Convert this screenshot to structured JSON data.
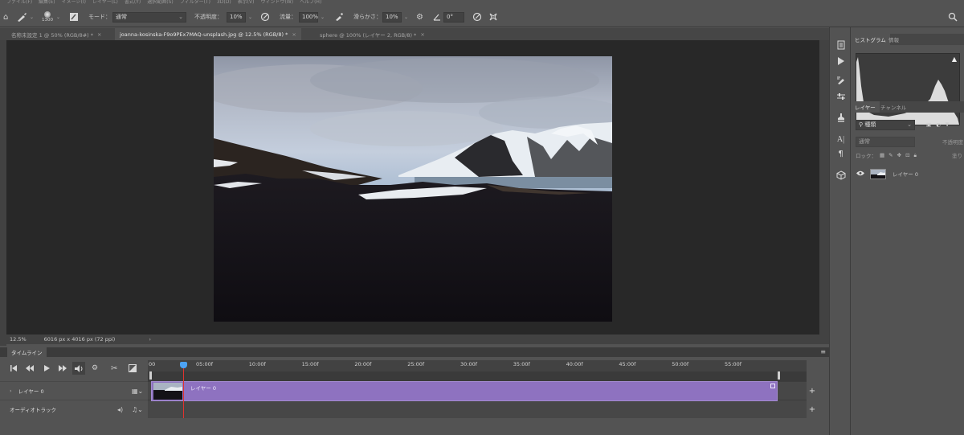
{
  "menu": [
    "ファイル(F)",
    "編集(E)",
    "イメージ(I)",
    "レイヤー(L)",
    "書式(Y)",
    "選択範囲(S)",
    "フィルター(T)",
    "3D(D)",
    "表示(V)",
    "ウィンドウ(W)",
    "ヘルプ(H)"
  ],
  "options": {
    "brush_size": "1300",
    "mode_label": "モード：",
    "mode_value": "通常",
    "opacity_label": "不透明度：",
    "opacity_value": "10%",
    "flow_label": "流量：",
    "flow_value": "100%",
    "smoothing_label": "滑らかさ：",
    "smoothing_value": "10%",
    "angle_value": "0°"
  },
  "tabs": [
    {
      "label": "名称未設定 1 @ 50% (RGB/8#) *",
      "close": "×"
    },
    {
      "label": "joanna-kosinska-F9o9PEx7MAQ-unsplash.jpg @ 12.5% (RGB/8) *",
      "close": "×"
    },
    {
      "label": "sphere @ 100% (レイヤー 2, RGB/8) *",
      "close": "×"
    }
  ],
  "status": {
    "zoom": "12.5%",
    "doc_info": "6016 px x 4016 px (72 ppi)",
    "arrow": "›"
  },
  "timeline": {
    "tab": "タイムライン",
    "menu": "≡",
    "ticks": [
      "00",
      "05:00f",
      "10:00f",
      "15:00f",
      "20:00f",
      "25:00f",
      "30:00f",
      "35:00f",
      "40:00f",
      "45:00f",
      "50:00f",
      "55:00f"
    ],
    "layer_track": "レイヤー 0",
    "audio_track": "オーディオトラック",
    "clip_label": "レイヤー 0",
    "plus": "+"
  },
  "panels": {
    "histogram_tab": "ヒストグラム",
    "info_tab": "情報",
    "layers_tab": "レイヤー",
    "channels_tab": "チャンネル",
    "kind_label": "種類",
    "blend_mode": "通常",
    "opacity_label": "不透明度",
    "lock_label": "ロック：",
    "fill_label": "塗り",
    "layer_name": "レイヤー 0"
  },
  "colors": {
    "clip": "#8e72c0",
    "playhead": "#e0332f",
    "playhead_handle": "#4ca3f5"
  }
}
